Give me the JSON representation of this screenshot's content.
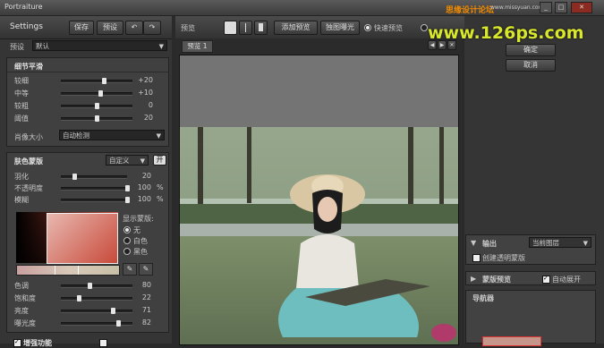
{
  "app": {
    "title": "Portraiture"
  },
  "watermark": {
    "top_cn": "思缘设计论坛",
    "top_url": "www.missyuan.com",
    "big": "www.126ps.com"
  },
  "header": {
    "settings": "Settings",
    "save": "保存",
    "preset_btn": "预设",
    "undo_icon": "↶",
    "redo_icon": "↷"
  },
  "preset": {
    "label": "预设",
    "value": "默认"
  },
  "detail": {
    "title": "细节平滑",
    "sliders": [
      {
        "label": "较细",
        "value": "+20",
        "level": 0.6
      },
      {
        "label": "中等",
        "value": "+10",
        "level": 0.55
      },
      {
        "label": "较粗",
        "value": "0",
        "level": 0.5
      },
      {
        "label": "阈值",
        "value": "20",
        "level": 0.5
      }
    ],
    "portrait_size_label": "肖像大小",
    "portrait_size_value": "自动检测"
  },
  "skin_mask": {
    "title": "肤色蒙版",
    "mode": "自定义",
    "toggle": "开",
    "sliders": [
      {
        "label": "羽化",
        "value": "20",
        "unit": "",
        "level": 0.2
      },
      {
        "label": "不透明度",
        "value": "100",
        "unit": "%",
        "level": 1.0
      },
      {
        "label": "模糊",
        "value": "100",
        "unit": "%",
        "level": 1.0
      }
    ],
    "show_mask_label": "显示蒙版:",
    "radios": [
      {
        "label": "无",
        "checked": true
      },
      {
        "label": "白色",
        "checked": false
      },
      {
        "label": "黑色",
        "checked": false
      }
    ],
    "hsl": [
      {
        "label": "色调",
        "value": "80",
        "level": 0.4
      },
      {
        "label": "饱和度",
        "value": "22",
        "level": 0.25
      },
      {
        "label": "亮度",
        "value": "71",
        "level": 0.72
      },
      {
        "label": "曝光度",
        "value": "82",
        "level": 0.8
      }
    ]
  },
  "bottom_left": {
    "enhance": "增强功能",
    "toggle": "开"
  },
  "preview_toolbar": {
    "label": "预览",
    "add_preview": "添加预览",
    "exposure": "独图曝光",
    "quick_preview": "快速预览",
    "tab": "预览 1"
  },
  "right": {
    "ok": "确定",
    "cancel": "取消",
    "output_label": "输出",
    "output_value": "当前图层",
    "create_mask": "创建透明蒙版",
    "mask_preview": "蒙版预览",
    "auto_expand": "自动展开",
    "navigator": "导航器"
  },
  "colors": {
    "panel": "#353535",
    "group": "#404040",
    "accent": "#d8e62c"
  }
}
